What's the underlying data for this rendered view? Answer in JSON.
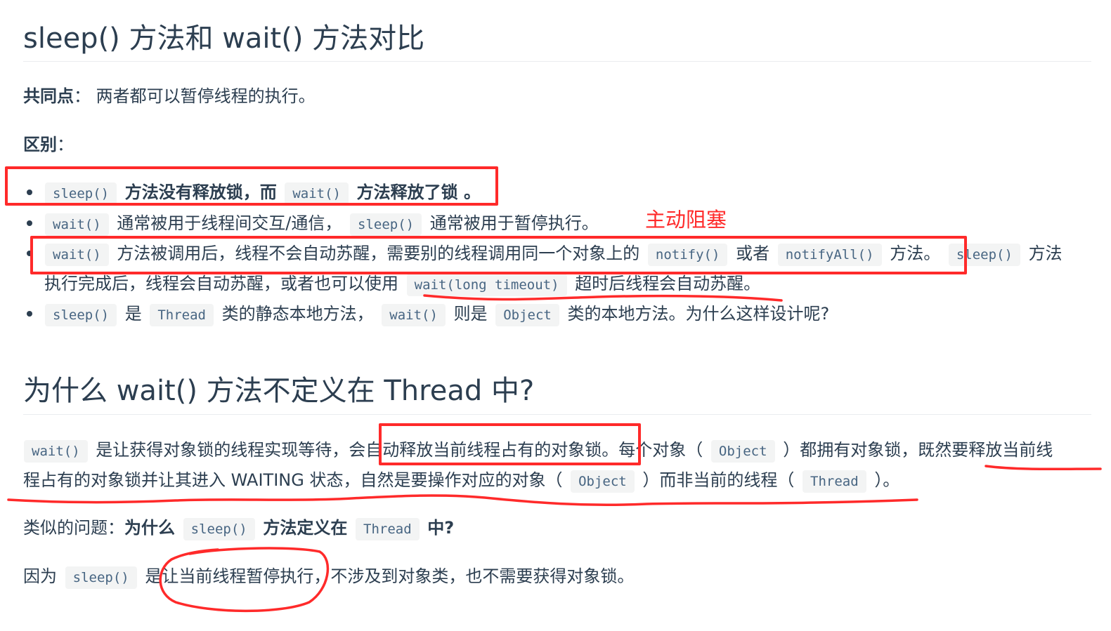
{
  "section1": {
    "title": "sleep() 方法和 wait() 方法对比",
    "common_label": "共同点",
    "common_sep": "：",
    "common_text": "两者都可以暂停线程的执行。",
    "diff_label": "区别",
    "diff_sep": "：",
    "items": [
      {
        "code1": "sleep()",
        "t1": "方法没有释放锁，而",
        "code2": "wait()",
        "t2": "方法释放了锁 。"
      },
      {
        "code1": "wait()",
        "t1": "通常被用于线程间交互/通信，",
        "code2": "sleep()",
        "t2": "通常被用于暂停执行。"
      },
      {
        "code1": "wait()",
        "t1": "方法被调用后，线程不会自动苏醒，需要别的线程调用同一个对象上的",
        "code2": "notify()",
        "t2": "或者",
        "code3": "notifyAll()",
        "t3": "方法。",
        "code4": "sleep()",
        "t4": "方法",
        "t5": "执行完成后，线程会自动苏醒，或者也可以使用",
        "code5": "wait(long timeout)",
        "t6": "超时后线程会自动苏醒。"
      },
      {
        "code1": "sleep()",
        "t1": "是",
        "code2": "Thread",
        "t2": "类的静态本地方法，",
        "code3": "wait()",
        "t3": "则是",
        "code4": "Object",
        "t4": "类的本地方法。为什么这样设计呢?"
      }
    ]
  },
  "section2": {
    "title": "为什么 wait() 方法不定义在 Thread 中?",
    "p1": {
      "code1": "wait()",
      "t1": "是让获得对象锁的线程实现等待，会自动释放当前线程占有的对象锁。每个对象（",
      "code2": "Object",
      "t2": "）都拥有对象锁，既然要释放当前线",
      "t3": "程占有的对象锁并让其进入 WAITING 状态，自然是要操作对应的对象（",
      "code3": "Object",
      "t4": "）而非当前的线程（",
      "code4": "Thread",
      "t5": "）。"
    },
    "p2": {
      "t1": "类似的问题：",
      "b1": "为什么",
      "code1": "sleep()",
      "b2": "方法定义在",
      "code2": "Thread",
      "b3": "中?"
    },
    "p3": {
      "t1": "因为",
      "code1": "sleep()",
      "t2": "是让当前线程暂停执行，不涉及到对象类，也不需要获得对象锁。"
    }
  },
  "annotation": {
    "note": "主动阻塞",
    "color": "#ff2a2a"
  }
}
